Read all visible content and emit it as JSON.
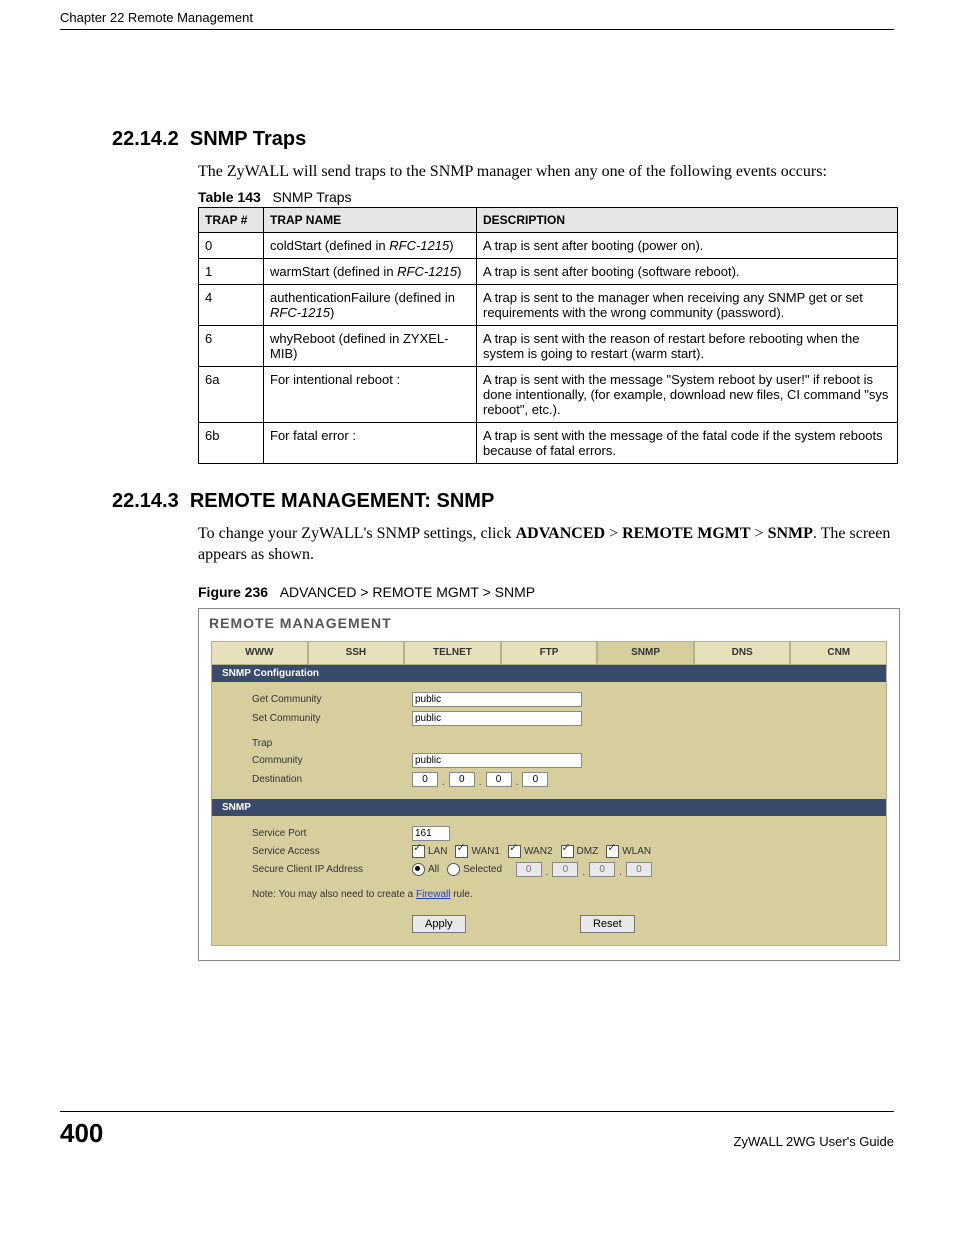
{
  "header": "Chapter 22 Remote Management",
  "section1": {
    "num": "22.14.2",
    "title": "SNMP Traps",
    "body": "The ZyWALL will send traps to the SNMP manager when any one of the following events occurs:",
    "table_caption_bold": "Table 143",
    "table_caption_rest": "SNMP Traps",
    "cols": [
      "TRAP #",
      "TRAP NAME",
      "DESCRIPTION"
    ],
    "rows": [
      {
        "num": "0",
        "name_a": "coldStart (defined in ",
        "name_i": "RFC-1215",
        "name_b": ")",
        "desc": "A trap is sent after booting (power on)."
      },
      {
        "num": "1",
        "name_a": "warmStart (defined in ",
        "name_i": "RFC-1215",
        "name_b": ")",
        "desc": "A trap is sent after booting (software reboot)."
      },
      {
        "num": "4",
        "name_a": "authenticationFailure (defined in ",
        "name_i": "RFC-1215",
        "name_b": ")",
        "desc": "A trap is sent to the manager when receiving any SNMP get or set requirements with the wrong community (password)."
      },
      {
        "num": "6",
        "name_a": "whyReboot (defined in ZYXEL-MIB)",
        "name_i": "",
        "name_b": "",
        "desc": "A trap is sent with the reason of restart before rebooting when the system is going to restart (warm start)."
      },
      {
        "num": "6a",
        "name_a": "For intentional reboot :",
        "name_i": "",
        "name_b": "",
        "desc": "A trap is sent with the message \"System reboot by user!\" if reboot is done intentionally, (for example, download new files, CI command \"sys reboot\", etc.)."
      },
      {
        "num": "6b",
        "name_a": "For fatal error :",
        "name_i": "",
        "name_b": "",
        "desc": "A trap is sent with the message of the fatal code if the system reboots because of fatal errors."
      }
    ]
  },
  "section2": {
    "num": "22.14.3",
    "title": "REMOTE MANAGEMENT: SNMP",
    "body_pre": "To change your ZyWALL's SNMP settings, click ",
    "bold1": "ADVANCED",
    "gt1": " > ",
    "bold2": "REMOTE MGMT",
    "gt2": " > ",
    "bold3": "SNMP",
    "body_post": ". The screen appears as shown.",
    "fig_bold": "Figure 236",
    "fig_rest": "ADVANCED > REMOTE MGMT > SNMP"
  },
  "screenshot": {
    "title": "REMOTE MANAGEMENT",
    "tabs": [
      "WWW",
      "SSH",
      "TELNET",
      "FTP",
      "SNMP",
      "DNS",
      "CNM"
    ],
    "active_tab": 4,
    "bar1": "SNMP Configuration",
    "get_comm_label": "Get Community",
    "get_comm_value": "public",
    "set_comm_label": "Set Community",
    "set_comm_value": "public",
    "trap_label": "Trap",
    "community_label": "Community",
    "community_value": "public",
    "dest_label": "Destination",
    "dest_ip": [
      "0",
      "0",
      "0",
      "0"
    ],
    "bar2": "SNMP",
    "port_label": "Service Port",
    "port_value": "161",
    "access_label": "Service Access",
    "access_opts": [
      {
        "label": "LAN",
        "checked": true
      },
      {
        "label": "WAN1",
        "checked": true
      },
      {
        "label": "WAN2",
        "checked": true
      },
      {
        "label": "DMZ",
        "checked": true
      },
      {
        "label": "WLAN",
        "checked": true
      }
    ],
    "secure_label": "Secure Client IP Address",
    "radio_all": "All",
    "radio_sel": "Selected",
    "secure_ip": [
      "0",
      "0",
      "0",
      "0"
    ],
    "note_pre": "Note: You may also need to create a ",
    "note_link": "Firewall",
    "note_post": " rule.",
    "btn_apply": "Apply",
    "btn_reset": "Reset"
  },
  "footer": {
    "page": "400",
    "guide": "ZyWALL 2WG User's Guide"
  }
}
